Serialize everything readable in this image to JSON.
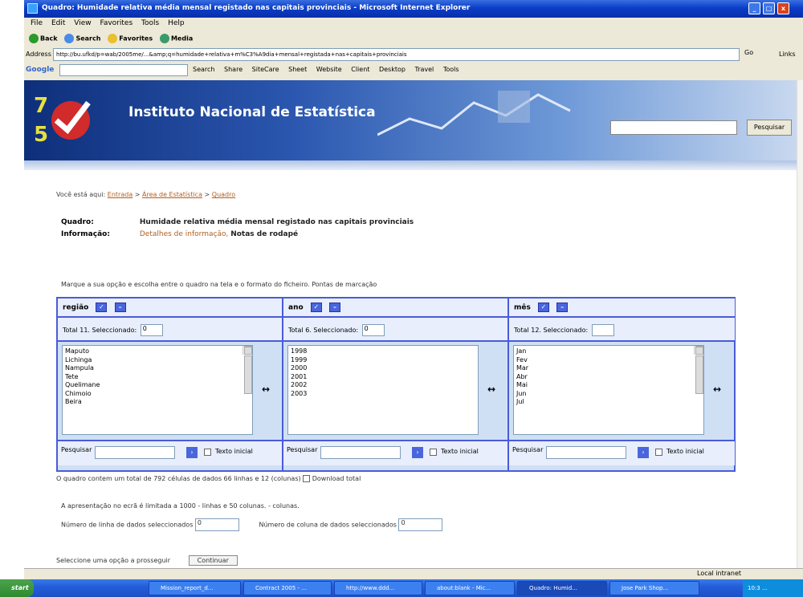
{
  "window": {
    "title": "Quadro: Humidade relativa média mensal registado nas capitais provinciais - Microsoft Internet Explorer",
    "controls": [
      "_",
      "□",
      "x"
    ]
  },
  "menu": [
    "File",
    "Edit",
    "View",
    "Favorites",
    "Tools",
    "Help"
  ],
  "toolbar": [
    "Back",
    "Search",
    "Favorites",
    "Media"
  ],
  "address": {
    "label": "Address",
    "url": "http://bu.ufkd/p=wab/2005me/...&amp;q=humidade+relativa+m%C3%A9dia+mensal+registada+nas+capitais+provinciais",
    "go": "Go",
    "links": "Links"
  },
  "google_bar": {
    "logo": "Google",
    "items": [
      "Search",
      "Share",
      "SiteCare",
      "Sheet",
      "Website",
      "Client",
      "Desktop",
      "Travel",
      "Tools"
    ]
  },
  "banner": {
    "name": "Instituto Nacional de Estatística",
    "search_button": "Pesquisar"
  },
  "breadcrumb": {
    "prefix": "Você está aqui:",
    "links": [
      "Entrada",
      "Área de Estatística",
      "Quadro"
    ],
    "sep": ">"
  },
  "info": {
    "quadro_label": "Quadro:",
    "quadro_value": "Humidade relativa média mensal registado nas capitais provinciais",
    "info_label": "Informação:",
    "info_link": "Detalhes de informação,",
    "info_value": "Notas de rodapé"
  },
  "instruction": "Marque a sua opção e escolha entre o quadro na tela e o formato do ficheiro. Pontas de marcação",
  "selection": [
    {
      "header": "região",
      "total": "Total 11. Seleccionado:",
      "selected": "0",
      "items": [
        "Maputo",
        "Lichinga",
        "Nampula",
        "Tete",
        "Quelimane",
        "Chimoio",
        "Beira"
      ],
      "search_label": "Pesquisar",
      "checkbox_label": "Texto inicial"
    },
    {
      "header": "ano",
      "total": "Total 6. Seleccionado:",
      "selected": "0",
      "items": [
        "1998",
        "1999",
        "2000",
        "2001",
        "2002",
        "2003"
      ],
      "search_label": "Pesquisar",
      "checkbox_label": "Texto inicial"
    },
    {
      "header": "mês",
      "total": "Total 12. Seleccionado:",
      "selected": "",
      "items": [
        "Jan",
        "Fev",
        "Mar",
        "Abr",
        "Mai",
        "Jun",
        "Jul"
      ],
      "search_label": "Pesquisar",
      "checkbox_label": "Texto inicial"
    }
  ],
  "summary": "O quadro contem um total de 792 células de dados 66 linhas e 12 (colunas)",
  "download_label": "Download total",
  "limit": "A apresentação no ecrã é limitada a  1000  - linhas e  50 colunas. - colunas.",
  "rows_label": "Número de linha de dados seleccionados",
  "rows_value": "0",
  "cols_label": "Número de coluna de dados seleccionados",
  "cols_value": "0",
  "select_prompt": "Seleccione uma opção a prosseguir",
  "continue_button": "Continuar",
  "status": {
    "zone": "Local intranet"
  },
  "taskbar": {
    "start": "start",
    "tasks": [
      "Mission_report_d...",
      "Contract 2005 - ...",
      "http://www.ddd...",
      "about:blank - Mic...",
      "Quadro: Humid...",
      "Jose Park Shop..."
    ],
    "tray": "10:3 ..."
  }
}
